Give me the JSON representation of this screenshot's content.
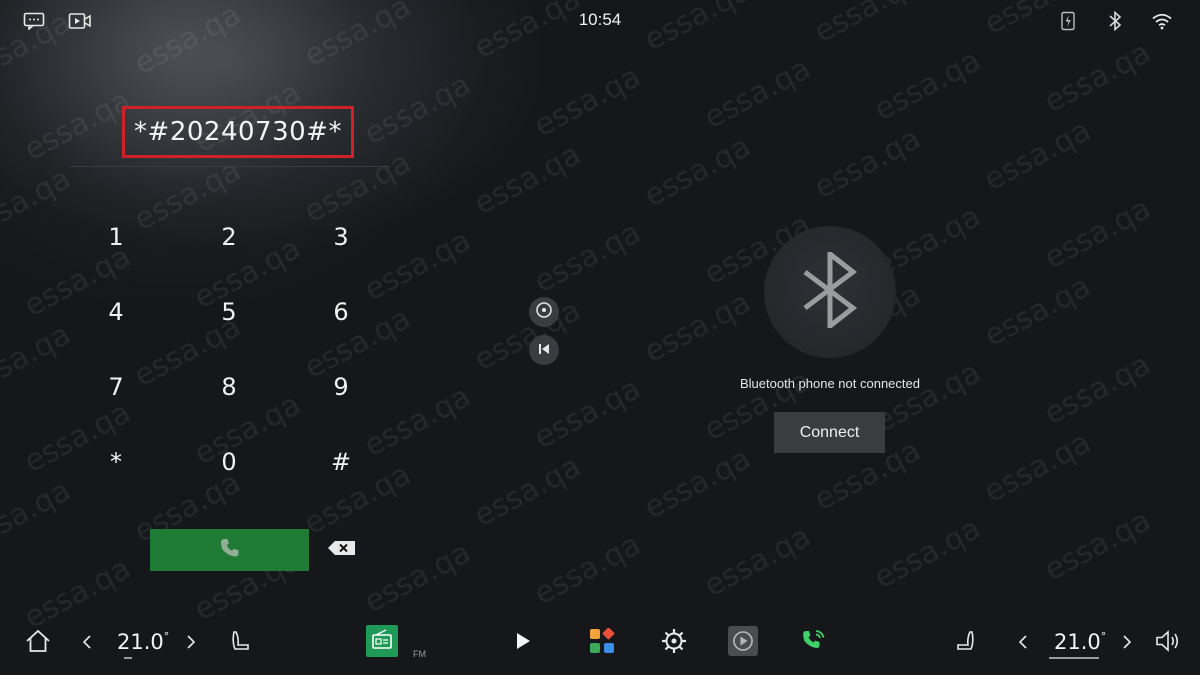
{
  "status_bar": {
    "time": "10:54",
    "left_icons": [
      "message-icon",
      "video-icon"
    ],
    "right_icons": [
      "phone-charge-icon",
      "bluetooth-icon",
      "wifi-icon"
    ]
  },
  "dialer": {
    "number": "*#20240730#*",
    "keys": [
      "1",
      "2",
      "3",
      "4",
      "5",
      "6",
      "7",
      "8",
      "9",
      "*",
      "0",
      "#"
    ]
  },
  "bluetooth": {
    "message": "Bluetooth phone not connected",
    "connect_label": "Connect"
  },
  "bottom_bar": {
    "left_temp": "21.0",
    "right_temp": "21.0",
    "degree_symbol": "°",
    "fm_label": "FM"
  },
  "watermark_text": "essa.qa",
  "colors": {
    "call_green": "#1f7a33",
    "highlight_red": "#d0202a",
    "radio_green": "#1f9a56"
  }
}
